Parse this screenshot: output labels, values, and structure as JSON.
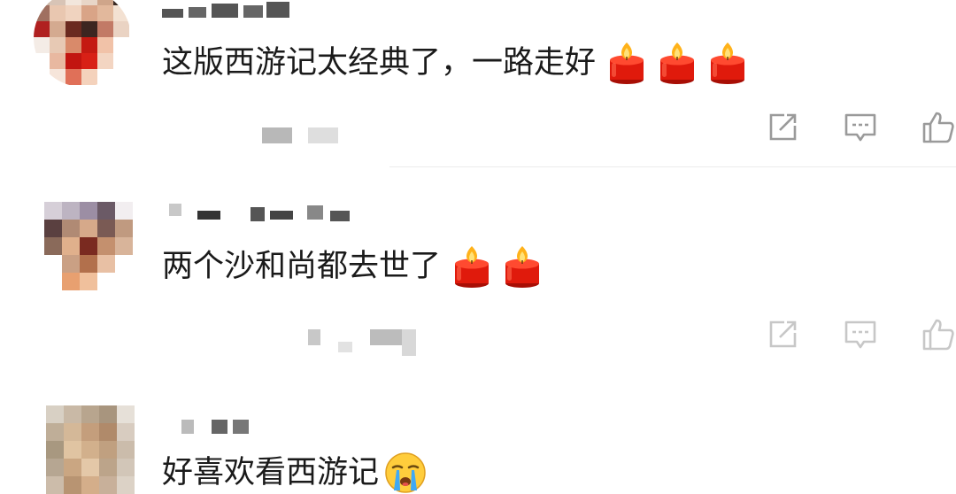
{
  "comments": [
    {
      "text": "这版西游记太经典了，一路走好",
      "reaction_icon": "candle-icon",
      "reaction_count": 3
    },
    {
      "text": "两个沙和尚都去世了",
      "reaction_icon": "candle-icon",
      "reaction_count": 2
    },
    {
      "text": "好喜欢看西游记",
      "reaction_icon": "crying-face-icon",
      "reaction_count": 1
    }
  ],
  "action_icons": [
    "share-icon",
    "reply-icon",
    "like-icon"
  ],
  "colors": {
    "text": "#1a1a1a",
    "icon": "#9a9a9a",
    "divider": "#ececec",
    "candle_red": "#e02010",
    "flame_yellow": "#ffc21a"
  }
}
